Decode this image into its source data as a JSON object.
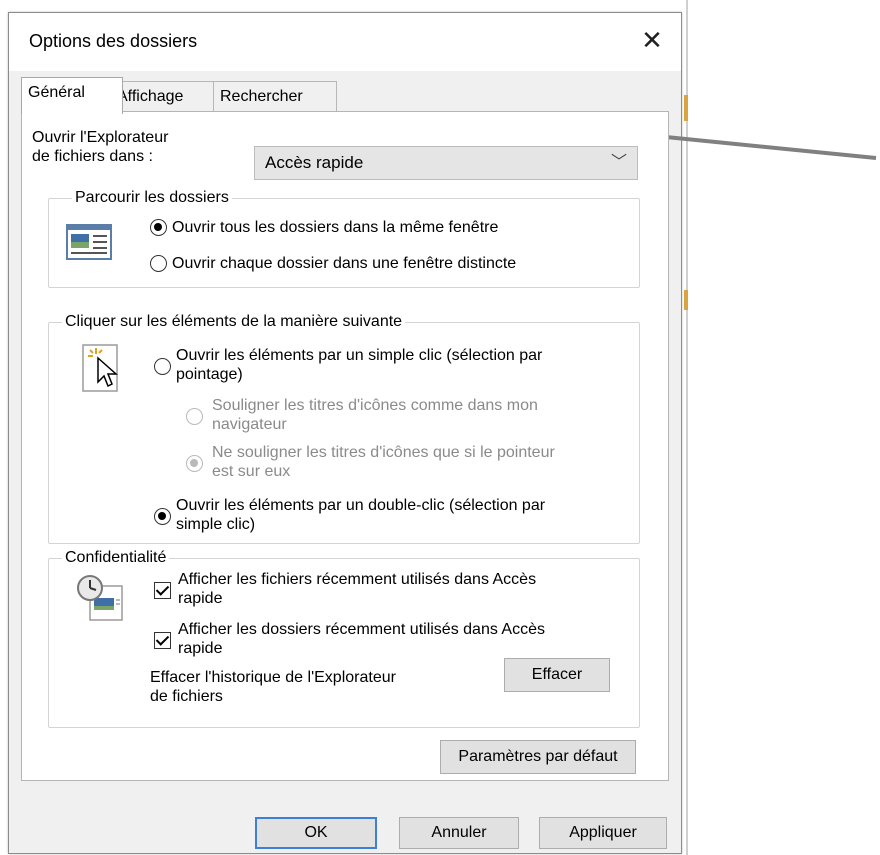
{
  "dialog": {
    "title": "Options des dossiers",
    "close_glyph": "✕"
  },
  "tabs": [
    {
      "label": "Général",
      "active": true
    },
    {
      "label": "Affichage",
      "active": false
    },
    {
      "label": "Rechercher",
      "active": false
    }
  ],
  "open_in": {
    "label_line1": "Ouvrir l'Explorateur",
    "label_line2": "de fichiers dans :",
    "selected": "Accès rapide",
    "chevron": "﹀"
  },
  "browse": {
    "title": "Parcourir les dossiers",
    "icon": "folder-window-icon",
    "options": [
      {
        "label": "Ouvrir tous les dossiers dans la même fenêtre",
        "checked": true
      },
      {
        "label": "Ouvrir chaque dossier dans une fenêtre distincte",
        "checked": false
      }
    ]
  },
  "click": {
    "title": "Cliquer sur les éléments de la manière suivante",
    "icon": "pointer-click-icon",
    "single": {
      "line1": "Ouvrir les éléments par un simple clic (sélection par",
      "line2": "pointage)",
      "checked": false
    },
    "underline_like_browser": {
      "line1": "Souligner les titres d'icônes comme dans mon",
      "line2": "navigateur",
      "checked": false
    },
    "underline_on_hover": {
      "line1": "Ne souligner les titres d'icônes que si le pointeur",
      "line2": "est sur eux",
      "checked": true
    },
    "double": {
      "line1": "Ouvrir les éléments par un double-clic (sélection par",
      "line2": "simple clic)",
      "checked": true
    }
  },
  "privacy": {
    "title": "Confidentialité",
    "icon": "clock-document-icon",
    "recent_files": {
      "line1": "Afficher les fichiers récemment utilisés dans Accès",
      "line2": "rapide",
      "checked": true
    },
    "recent_folders": {
      "line1": "Afficher les dossiers récemment utilisés dans Accès",
      "line2": "rapide",
      "checked": true
    },
    "clear_line1": "Effacer l'historique de l'Explorateur",
    "clear_line2": "de fichiers",
    "clear_button": "Effacer"
  },
  "buttons": {
    "defaults": "Paramètres par défaut",
    "ok": "OK",
    "cancel": "Annuler",
    "apply": "Appliquer"
  },
  "colors": {
    "accent": "#3c7fd6",
    "annotation_arrow": "#808080"
  }
}
